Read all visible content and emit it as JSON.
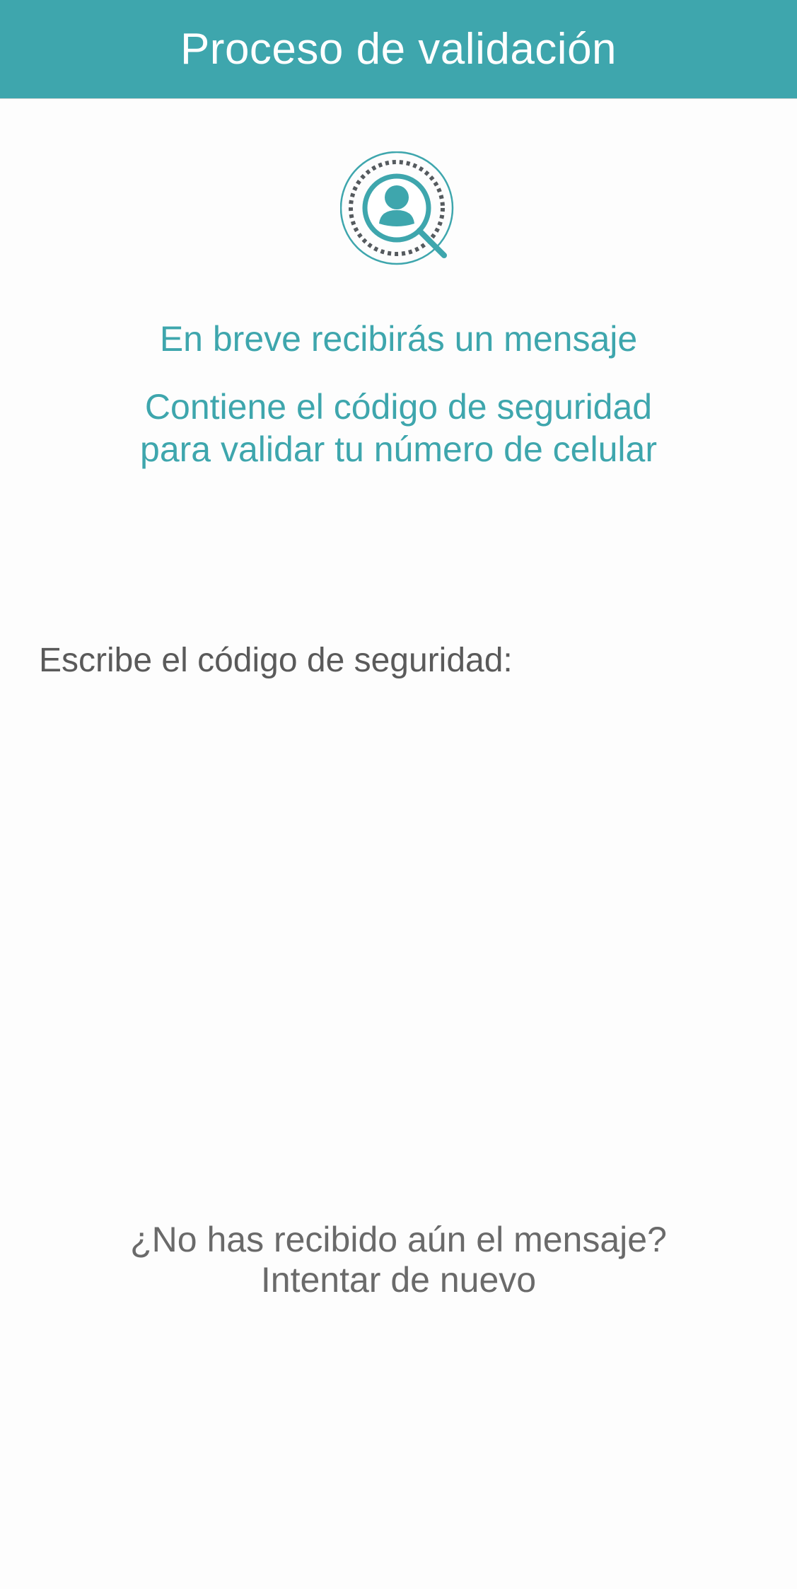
{
  "header": {
    "title": "Proceso de validación",
    "background_color": "#3ea6ad"
  },
  "hero": {
    "icon": "user-search-icon"
  },
  "messages": {
    "line1": "En breve recibirás un mensaje",
    "line2a": "Contiene el código de seguridad",
    "line2b": "para validar tu número de celular",
    "accent_color": "#3ea6ad"
  },
  "code": {
    "label": "Escribe el código de seguridad:",
    "value": ""
  },
  "resend": {
    "question": "¿No has recibido aún el mensaje?",
    "link": "Intentar de nuevo",
    "text_color": "#6a6a6a"
  }
}
